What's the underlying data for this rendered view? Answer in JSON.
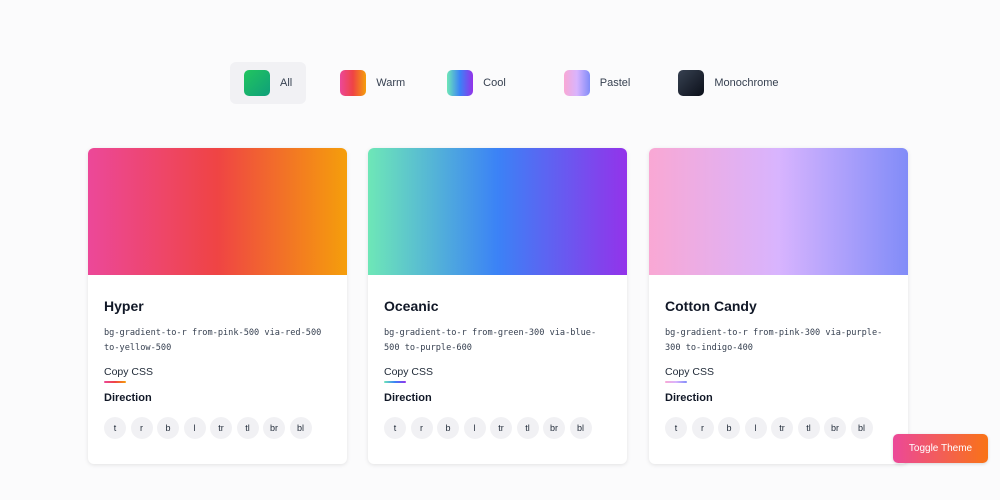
{
  "filters": [
    {
      "label": "All",
      "icon": "all-swatch-icon",
      "active": true
    },
    {
      "label": "Warm",
      "icon": "warm-swatch-icon",
      "active": false
    },
    {
      "label": "Cool",
      "icon": "cool-swatch-icon",
      "active": false
    },
    {
      "label": "Pastel",
      "icon": "pastel-swatch-icon",
      "active": false
    },
    {
      "label": "Monochrome",
      "icon": "monochrome-swatch-icon",
      "active": false
    }
  ],
  "cards": [
    {
      "title": "Hyper",
      "classes": "bg-gradient-to-r from-pink-500 via-red-500 to-yellow-500",
      "copy_label": "Copy CSS",
      "direction_heading": "Direction",
      "colors": [
        "#ec4899",
        "#ef4444",
        "#f59e0b"
      ]
    },
    {
      "title": "Oceanic",
      "classes": "bg-gradient-to-r from-green-300 via-blue-500 to-purple-600",
      "copy_label": "Copy CSS",
      "direction_heading": "Direction",
      "colors": [
        "#6ee7b7",
        "#3b82f6",
        "#9333ea"
      ]
    },
    {
      "title": "Cotton Candy",
      "classes": "bg-gradient-to-r from-pink-300 via-purple-300 to-indigo-400",
      "copy_label": "Copy CSS",
      "direction_heading": "Direction",
      "colors": [
        "#f9a8d4",
        "#d8b4fe",
        "#818cf8"
      ]
    }
  ],
  "directions": [
    "t",
    "r",
    "b",
    "l",
    "tr",
    "tl",
    "br",
    "bl"
  ],
  "toggle_theme_label": "Toggle Theme",
  "toggle_theme_colors": [
    "#ec4899",
    "#f97316"
  ]
}
